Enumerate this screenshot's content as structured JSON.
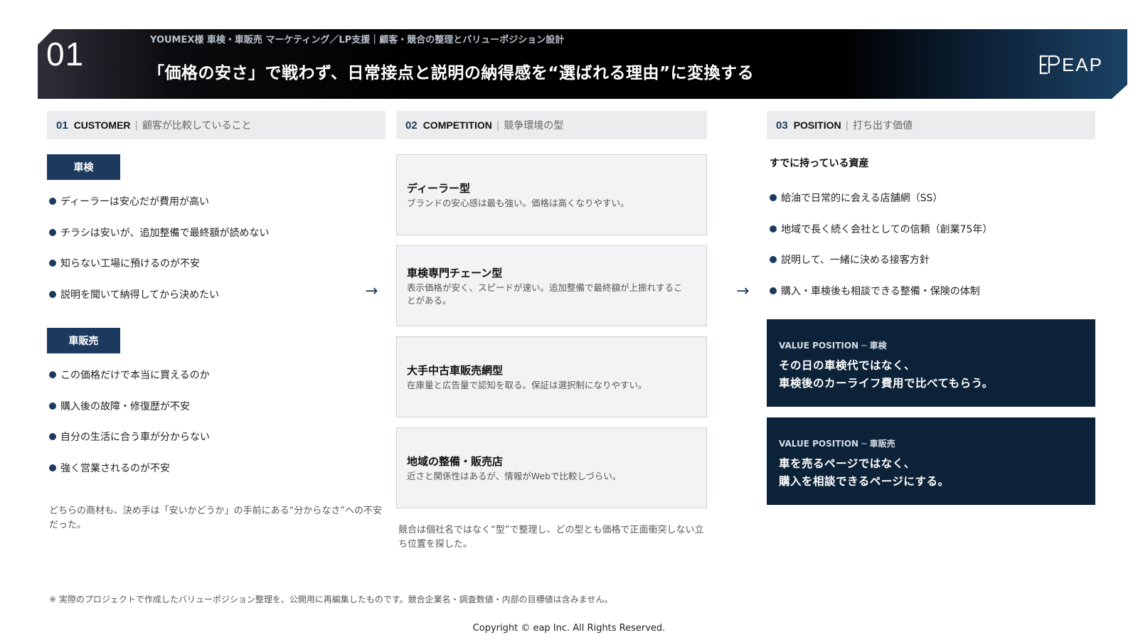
{
  "header": {
    "number": "01",
    "subtitle": "YOUMEX様 車検・車販売 マーケティング／LP支援｜顧客・競合の整理とバリューポジション設計",
    "title": "「価格の安さ」で戦わず、日常接点と説明の納得感を“選ばれる理由”に変換する",
    "logo_text": "EAP"
  },
  "columns": [
    {
      "num": "01",
      "en": "CUSTOMER",
      "ja": "顧客が比較していること"
    },
    {
      "num": "02",
      "en": "COMPETITION",
      "ja": "競争環境の型"
    },
    {
      "num": "03",
      "en": "POSITION",
      "ja": "打ち出す価値"
    }
  ],
  "customer": {
    "groups": [
      {
        "tag": "車検",
        "items": [
          "ディーラーは安心だが費用が高い",
          "チラシは安いが、追加整備で最終額が読めない",
          "知らない工場に預けるのが不安",
          "説明を聞いて納得してから決めたい"
        ]
      },
      {
        "tag": "車販売",
        "items": [
          "この価格だけで本当に買えるのか",
          "購入後の故障・修復歴が不安",
          "自分の生活に合う車が分からない",
          "強く営業されるのが不安"
        ]
      }
    ],
    "note": "どちらの商材も、決め手は「安いかどうか」の手前にある“分からなさ”への不安だった。"
  },
  "competition": {
    "cards": [
      {
        "title": "ディーラー型",
        "desc": "ブランドの安心感は最も強い。価格は高くなりやすい。"
      },
      {
        "title": "車検専門チェーン型",
        "desc": "表示価格が安く、スピードが速い。追加整備で最終額が上振れすることがある。"
      },
      {
        "title": "大手中古車販売網型",
        "desc": "在庫量と広告量で認知を取る。保証は選択制になりやすい。"
      },
      {
        "title": "地域の整備・販売店",
        "desc": "近さと関係性はあるが、情報がWebで比較しづらい。"
      }
    ],
    "note": "競合は個社名ではなく“型”で整理し、どの型とも価格で正面衝突しない立ち位置を探した。"
  },
  "position": {
    "assets_title": "すでに持っている資産",
    "assets": [
      "給油で日常的に会える店舗網（SS）",
      "地域で長く続く会社としての信頼（創業75年）",
      "説明して、一緒に決める接客方針",
      "購入・車検後も相談できる整備・保険の体制"
    ],
    "value_positions": [
      {
        "label": "VALUE POSITION ─ 車検",
        "lines": [
          "その日の車検代ではなく、",
          "車検後のカーライフ費用で比べてもらう。"
        ]
      },
      {
        "label": "VALUE POSITION ─ 車販売",
        "lines": [
          "車を売るページではなく、",
          "購入を相談できるページにする。"
        ]
      }
    ]
  },
  "arrows": [
    "→",
    "→"
  ],
  "footnote": "※ 実際のプロジェクトで作成したバリューポジション整理を、公開用に再編集したものです。競合企業名・調査数値・内部の目標値は含みません。",
  "copyright": "Copyright © eap Inc. All Rights Reserved.",
  "colors": {
    "navy": "#1c3a5e",
    "dark_navy": "#0c2238",
    "header_bg": "#000000",
    "col_head_bg": "#ececee"
  }
}
